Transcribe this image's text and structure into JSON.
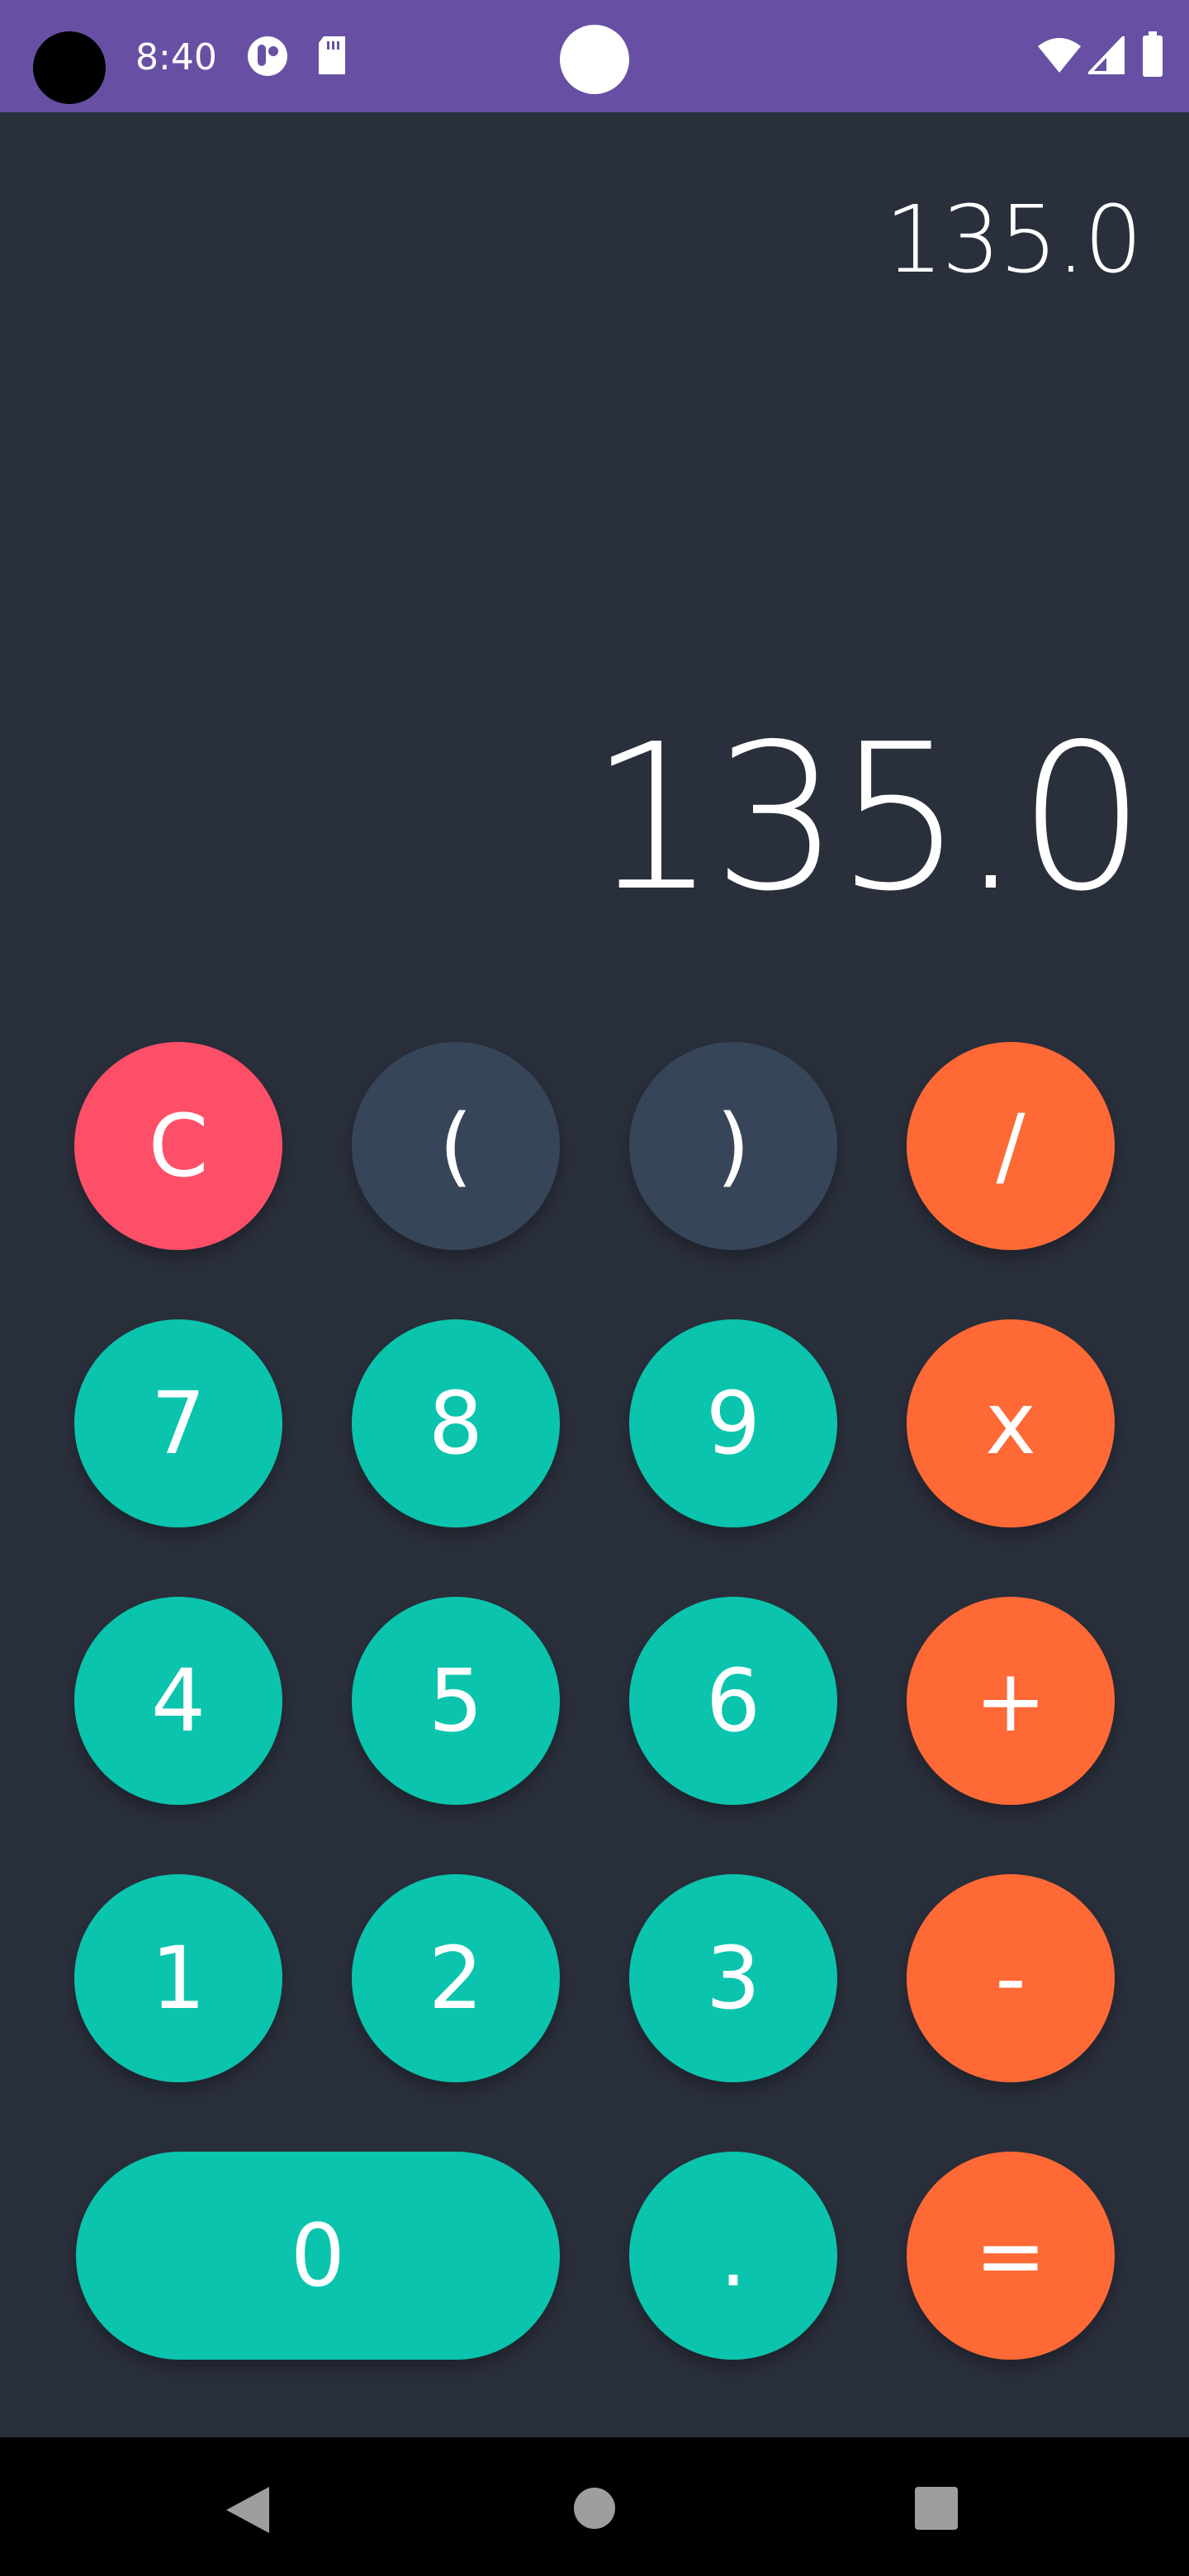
{
  "status_bar": {
    "time": "8:40",
    "background": "#6750a4",
    "icons": [
      "camera-cutout",
      "app-notification-icon",
      "sd-card-icon",
      "wifi-icon",
      "signal-icon",
      "battery-icon"
    ]
  },
  "display": {
    "expression": "135.0",
    "result": "135.0"
  },
  "keypad": {
    "row1": [
      "C",
      "(",
      ")",
      "/"
    ],
    "row2": [
      "7",
      "8",
      "9",
      "x"
    ],
    "row3": [
      "4",
      "5",
      "6",
      "+"
    ],
    "row4": [
      "1",
      "2",
      "3",
      "-"
    ],
    "row5": [
      "0",
      ".",
      "="
    ]
  },
  "colors": {
    "background": "#2a2f3c",
    "clear": "#fe4f68",
    "paren": "#374559",
    "operator": "#fe6935",
    "number": "#0bc4ad"
  },
  "nav_bar": {
    "buttons": [
      "back-icon",
      "home-icon",
      "recents-icon"
    ]
  }
}
